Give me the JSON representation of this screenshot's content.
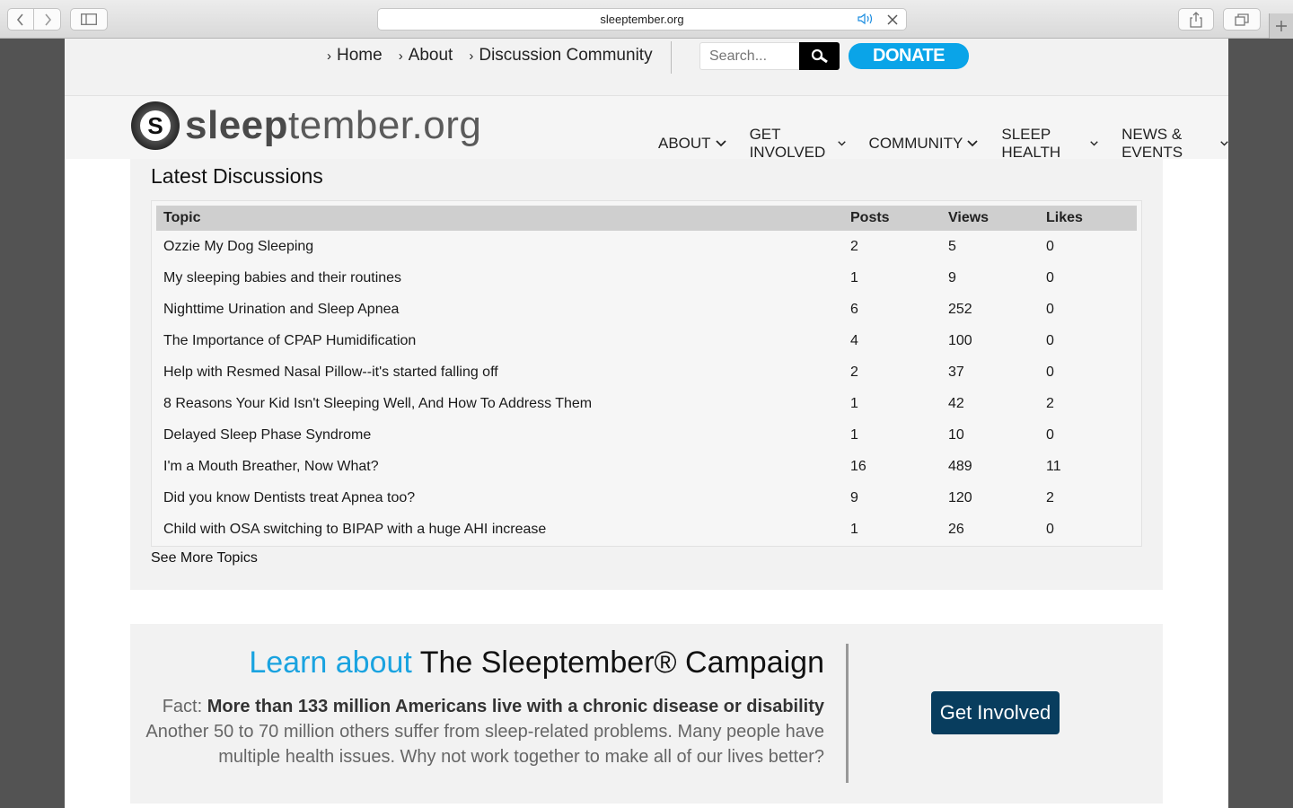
{
  "browser": {
    "url": "sleeptember.org"
  },
  "topbar": {
    "links": [
      "Home",
      "About",
      "Discussion Community"
    ],
    "search_placeholder": "Search...",
    "donate_label": "DONATE"
  },
  "header": {
    "logo_initial": "S",
    "logo_bold": "sleep",
    "logo_rest": "tember.org",
    "nav": [
      "ABOUT",
      "GET INVOLVED",
      "COMMUNITY",
      "SLEEP HEALTH",
      "NEWS & EVENTS"
    ]
  },
  "discussions": {
    "heading": "Latest Discussions",
    "columns": [
      "Topic",
      "Posts",
      "Views",
      "Likes"
    ],
    "rows": [
      [
        "Ozzie My Dog Sleeping",
        "2",
        "5",
        "0"
      ],
      [
        "My sleeping babies and their routines",
        "1",
        "9",
        "0"
      ],
      [
        "Nighttime Urination and Sleep Apnea",
        "6",
        "252",
        "0"
      ],
      [
        "The Importance of CPAP Humidification",
        "4",
        "100",
        "0"
      ],
      [
        "Help with Resmed Nasal Pillow--it's started falling off",
        "2",
        "37",
        "0"
      ],
      [
        "8 Reasons Your Kid Isn't Sleeping Well, And How To Address Them",
        "1",
        "42",
        "2"
      ],
      [
        "Delayed Sleep Phase Syndrome",
        "1",
        "10",
        "0"
      ],
      [
        "I'm a Mouth Breather, Now What?",
        "16",
        "489",
        "11"
      ],
      [
        "Did you know Dentists treat Apnea too?",
        "9",
        "120",
        "2"
      ],
      [
        "Child with OSA switching to BIPAP with a huge AHI increase",
        "1",
        "26",
        "0"
      ]
    ],
    "see_more": "See More Topics"
  },
  "campaign": {
    "title_lead": "Learn about",
    "title_name": "The Sleeptember® Campaign",
    "fact_prefix": "Fact:",
    "fact_bold": "More than 133 million Americans live with a chronic disease or disability",
    "fact_body": "Another 50 to 70 million others suffer from sleep-related problems. Many people have multiple health issues. Why not work together to make all of our lives better?",
    "button_label": "Get Involved"
  },
  "colors": {
    "donate": "#0aa4e8",
    "learn_accent": "#1aa3e0",
    "get_involved": "#083d5e"
  }
}
